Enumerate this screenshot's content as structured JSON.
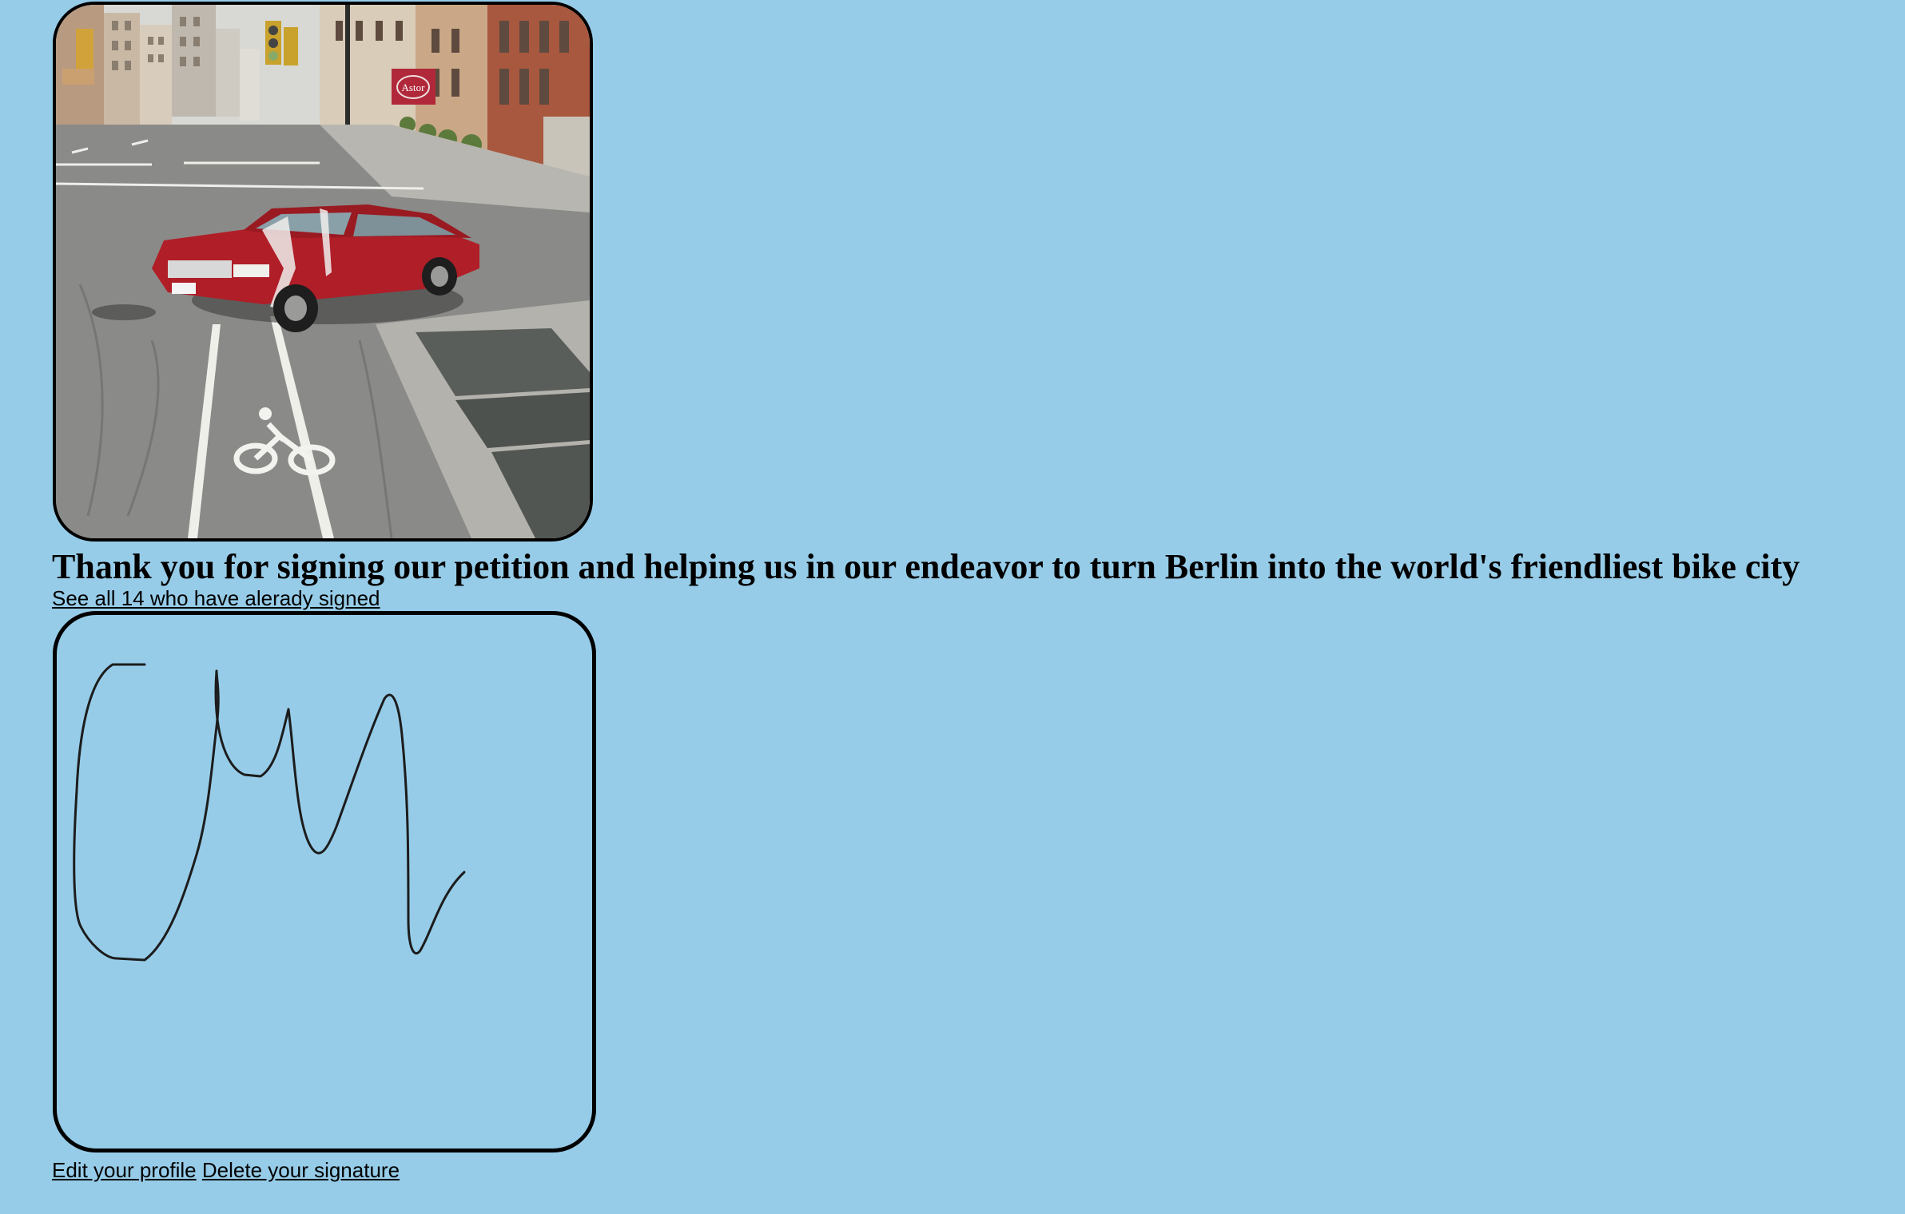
{
  "petition": {
    "headline": "Thank you for signing our petition and helping us in our endeavor to turn Berlin into the world's friendliest bike city",
    "signed_link": "See all 14 who have alerady signed"
  },
  "photo": {
    "sign_text": "Astor"
  },
  "actions": {
    "edit_profile": "Edit your profile",
    "delete_signature": "Delete your signature"
  }
}
